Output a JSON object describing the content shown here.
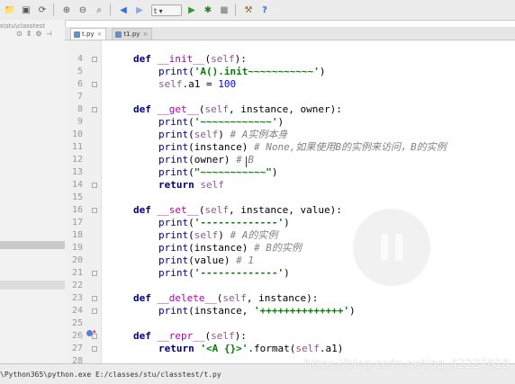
{
  "toolbar": {
    "run_config": "t",
    "icons": [
      "open-icon",
      "save-icon",
      "sync-icon",
      "zoom-in-icon",
      "zoom-out-icon",
      "find-icon",
      "back-icon",
      "forward-icon",
      "run-icon",
      "debug-icon",
      "stop-icon",
      "settings-icon",
      "help-icon"
    ]
  },
  "project": {
    "path": "s\\stu\\classtest"
  },
  "tabs": [
    {
      "label": "t.py",
      "close": "×",
      "active": true
    },
    {
      "label": "t1.py",
      "close": "×",
      "active": false
    }
  ],
  "code_lines": [
    {
      "num": "4",
      "indent": 1,
      "tokens": [
        {
          "t": "kw",
          "v": "def"
        },
        {
          "t": "",
          "v": " "
        },
        {
          "t": "magic",
          "v": "__init__"
        },
        {
          "t": "",
          "v": "("
        },
        {
          "t": "self",
          "v": "self"
        },
        {
          "t": "",
          "v": "):"
        }
      ]
    },
    {
      "num": "5",
      "indent": 2,
      "tokens": [
        {
          "t": "builtin",
          "v": "print"
        },
        {
          "t": "",
          "v": "("
        },
        {
          "t": "str",
          "v": "'A().init~~~~~~~~~~~'"
        },
        {
          "t": "",
          "v": ")"
        }
      ]
    },
    {
      "num": "6",
      "indent": 2,
      "tokens": [
        {
          "t": "self",
          "v": "self"
        },
        {
          "t": "",
          "v": ".a1 = "
        },
        {
          "t": "num",
          "v": "100"
        }
      ]
    },
    {
      "num": "7",
      "indent": 0,
      "tokens": []
    },
    {
      "num": "8",
      "indent": 1,
      "tokens": [
        {
          "t": "kw",
          "v": "def"
        },
        {
          "t": "",
          "v": " "
        },
        {
          "t": "magic",
          "v": "__get__"
        },
        {
          "t": "",
          "v": "("
        },
        {
          "t": "self",
          "v": "self"
        },
        {
          "t": "",
          "v": ", instance, owner):"
        }
      ]
    },
    {
      "num": "9",
      "indent": 2,
      "tokens": [
        {
          "t": "builtin",
          "v": "print"
        },
        {
          "t": "",
          "v": "("
        },
        {
          "t": "str",
          "v": "'~~~~~~~~~~~~'"
        },
        {
          "t": "",
          "v": ")"
        }
      ]
    },
    {
      "num": "10",
      "indent": 2,
      "tokens": [
        {
          "t": "builtin",
          "v": "print"
        },
        {
          "t": "",
          "v": "("
        },
        {
          "t": "self",
          "v": "self"
        },
        {
          "t": "",
          "v": ") "
        },
        {
          "t": "cm",
          "v": "# A实例本身"
        }
      ]
    },
    {
      "num": "11",
      "indent": 2,
      "tokens": [
        {
          "t": "builtin",
          "v": "print"
        },
        {
          "t": "",
          "v": "(instance) "
        },
        {
          "t": "cm",
          "v": "# None,如果使用B的实例来访问，B的实例"
        }
      ]
    },
    {
      "num": "12",
      "indent": 2,
      "tokens": [
        {
          "t": "builtin",
          "v": "print"
        },
        {
          "t": "",
          "v": "(owner) "
        },
        {
          "t": "cm",
          "v": "# B"
        }
      ]
    },
    {
      "num": "13",
      "indent": 2,
      "tokens": [
        {
          "t": "builtin",
          "v": "print"
        },
        {
          "t": "",
          "v": "("
        },
        {
          "t": "str",
          "v": "\"~~~~~~~~~~~\""
        },
        {
          "t": "",
          "v": ")"
        }
      ]
    },
    {
      "num": "14",
      "indent": 2,
      "tokens": [
        {
          "t": "kw",
          "v": "return"
        },
        {
          "t": "",
          "v": " "
        },
        {
          "t": "self",
          "v": "self"
        }
      ]
    },
    {
      "num": "15",
      "indent": 0,
      "tokens": []
    },
    {
      "num": "16",
      "indent": 1,
      "tokens": [
        {
          "t": "kw",
          "v": "def"
        },
        {
          "t": "",
          "v": " "
        },
        {
          "t": "magic",
          "v": "__set__"
        },
        {
          "t": "",
          "v": "("
        },
        {
          "t": "self",
          "v": "self"
        },
        {
          "t": "",
          "v": ", instance, value):"
        }
      ]
    },
    {
      "num": "17",
      "indent": 2,
      "tokens": [
        {
          "t": "builtin",
          "v": "print"
        },
        {
          "t": "",
          "v": "("
        },
        {
          "t": "str",
          "v": "'-------------'"
        },
        {
          "t": "",
          "v": ")"
        }
      ]
    },
    {
      "num": "18",
      "indent": 2,
      "tokens": [
        {
          "t": "builtin",
          "v": "print"
        },
        {
          "t": "",
          "v": "("
        },
        {
          "t": "self",
          "v": "self"
        },
        {
          "t": "",
          "v": ") "
        },
        {
          "t": "cm",
          "v": "# A的实例"
        }
      ]
    },
    {
      "num": "19",
      "indent": 2,
      "tokens": [
        {
          "t": "builtin",
          "v": "print"
        },
        {
          "t": "",
          "v": "(instance) "
        },
        {
          "t": "cm",
          "v": "# B的实例"
        }
      ]
    },
    {
      "num": "20",
      "indent": 2,
      "tokens": [
        {
          "t": "builtin",
          "v": "print"
        },
        {
          "t": "",
          "v": "(value) "
        },
        {
          "t": "cm",
          "v": "# 1"
        }
      ]
    },
    {
      "num": "21",
      "indent": 2,
      "tokens": [
        {
          "t": "builtin",
          "v": "print"
        },
        {
          "t": "",
          "v": "("
        },
        {
          "t": "str",
          "v": "'-------------'"
        },
        {
          "t": "",
          "v": ")"
        }
      ]
    },
    {
      "num": "22",
      "indent": 0,
      "tokens": []
    },
    {
      "num": "23",
      "indent": 1,
      "tokens": [
        {
          "t": "kw",
          "v": "def"
        },
        {
          "t": "",
          "v": " "
        },
        {
          "t": "magic",
          "v": "__delete__"
        },
        {
          "t": "",
          "v": "("
        },
        {
          "t": "self",
          "v": "self"
        },
        {
          "t": "",
          "v": ", instance):"
        }
      ]
    },
    {
      "num": "24",
      "indent": 2,
      "tokens": [
        {
          "t": "builtin",
          "v": "print"
        },
        {
          "t": "",
          "v": "(instance, "
        },
        {
          "t": "str",
          "v": "'++++++++++++++'"
        },
        {
          "t": "",
          "v": ")"
        }
      ]
    },
    {
      "num": "25",
      "indent": 0,
      "tokens": []
    },
    {
      "num": "26",
      "indent": 1,
      "tokens": [
        {
          "t": "kw",
          "v": "def"
        },
        {
          "t": "",
          "v": " "
        },
        {
          "t": "magic",
          "v": "__repr__"
        },
        {
          "t": "",
          "v": "("
        },
        {
          "t": "self",
          "v": "self"
        },
        {
          "t": "",
          "v": "):"
        }
      ]
    },
    {
      "num": "27",
      "indent": 2,
      "tokens": [
        {
          "t": "kw",
          "v": "return"
        },
        {
          "t": "",
          "v": " "
        },
        {
          "t": "str",
          "v": "'<A {}>'"
        },
        {
          "t": "",
          "v": ".format("
        },
        {
          "t": "self",
          "v": "self"
        },
        {
          "t": "",
          "v": ".a1)"
        }
      ]
    },
    {
      "num": "28",
      "indent": 0,
      "tokens": []
    }
  ],
  "status": {
    "command": "\\Python365\\python.exe E:/classes/stu/classtest/t.py"
  },
  "watermark": "https://blog.csdn.net/qq_42227818"
}
